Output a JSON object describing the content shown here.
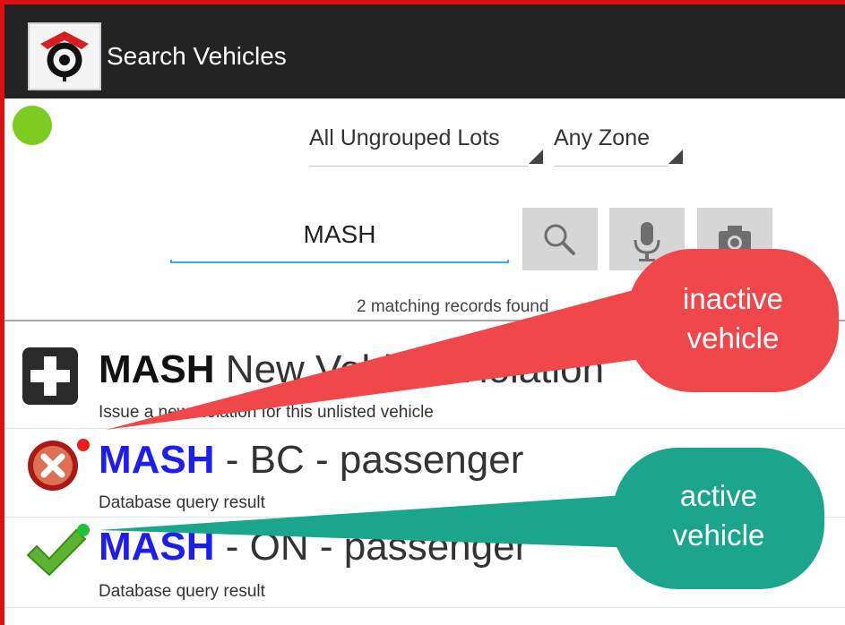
{
  "appbar": {
    "title": "Search Vehicles",
    "logo_icon": "shield-logo-icon"
  },
  "status": {
    "color": "#7ccc22"
  },
  "filters": {
    "lot": "All Ungrouped Lots",
    "zone": "Any Zone"
  },
  "search": {
    "value": "MASH",
    "placeholder": ""
  },
  "buttons": {
    "search_icon": "search-icon",
    "mic_icon": "microphone-icon",
    "camera_icon": "camera-icon"
  },
  "results": {
    "count_text": "2 matching records found",
    "items": [
      {
        "plate": "MASH",
        "title_rest": " New Vehicle Violation",
        "subtitle": "Issue a new violation for this unlisted vehicle",
        "icon": "add-icon"
      },
      {
        "plate": "MASH",
        "title_rest": " - BC - passenger",
        "subtitle": "Database query result",
        "icon": "inactive-x-icon"
      },
      {
        "plate": "MASH",
        "title_rest": " - ON - passenger",
        "subtitle": "Database query result",
        "icon": "active-check-icon"
      }
    ]
  },
  "callouts": {
    "inactive": {
      "line1": "inactive",
      "line2": "vehicle",
      "color": "#f0474a"
    },
    "active": {
      "line1": "active",
      "line2": "vehicle",
      "color": "#1aa58c"
    }
  },
  "colors": {
    "accent": "#3ea9dc",
    "appbar": "#232323",
    "plate_link": "#1d1df0",
    "frame": "#e01010"
  }
}
